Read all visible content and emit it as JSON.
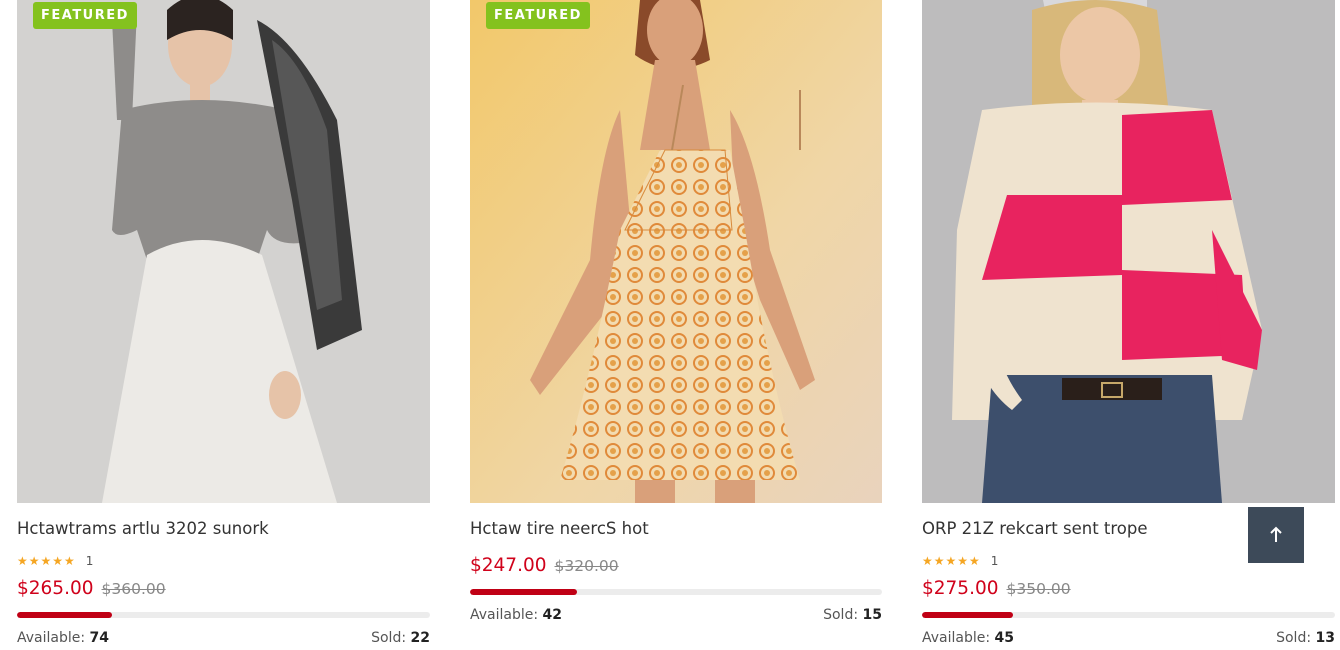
{
  "products": [
    {
      "badge": "FEATURED",
      "title": "Hctawtrams artlu 3202 sunork",
      "stars": "★★★★★",
      "review_count": "1",
      "price": "$265.00",
      "old_price": "$360.00",
      "progress": 0.23,
      "available_label": "Available:",
      "available": "74",
      "sold_label": "Sold:",
      "sold": "22"
    },
    {
      "badge": "FEATURED",
      "title": "Hctaw tire neercS hot",
      "price": "$247.00",
      "old_price": "$320.00",
      "progress": 0.26,
      "available_label": "Available:",
      "available": "42",
      "sold_label": "Sold:",
      "sold": "15"
    },
    {
      "title": "ORP 21Z rekcart sent trope",
      "stars": "★★★★★",
      "review_count": "1",
      "price": "$275.00",
      "old_price": "$350.00",
      "progress": 0.22,
      "available_label": "Available:",
      "available": "45",
      "sold_label": "Sold:",
      "sold": "13"
    }
  ],
  "scroll_top": {
    "icon": "arrow-up-icon"
  },
  "colors": {
    "badge": "#84c21e",
    "price": "#d0021b",
    "progress": "#c00015",
    "back_to_top": "#3d4a59"
  }
}
